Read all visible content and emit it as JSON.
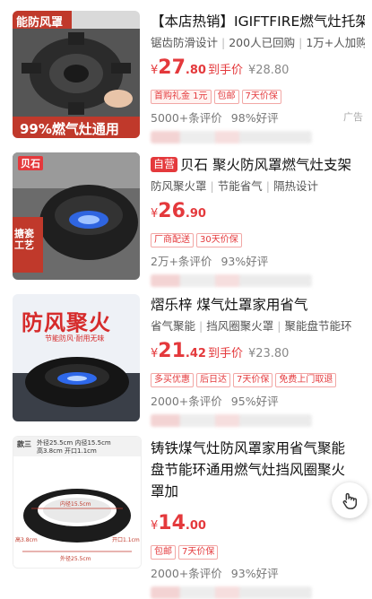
{
  "products": [
    {
      "image_text": [
        "能防风罩",
        "99%燃气灶通用"
      ],
      "title": "【本店热销】IGIFTFIRE燃气灶托架铸",
      "sub": [
        "锯齿防滑设计",
        "200人已回购",
        "1万+人加购"
      ],
      "currency": "¥",
      "price_int": "27",
      "price_dec": ".80",
      "after_label": "到手价",
      "original_price": "¥28.80",
      "chips": [
        "首购礼金 1元",
        "包邮",
        "7天价保"
      ],
      "reviews": "5000+条评价",
      "rating": "98%好评",
      "ad_label": "广告"
    },
    {
      "image_text": [
        "贝石",
        "搪瓷工艺"
      ],
      "badge": "自营",
      "title": "贝石 聚火防风罩燃气灶支架",
      "sub": [
        "防风聚火罩",
        "节能省气",
        "隔热设计"
      ],
      "currency": "¥",
      "price_int": "26",
      "price_dec": ".90",
      "chips": [
        "厂商配送",
        "30天价保"
      ],
      "reviews": "2万+条评价",
      "rating": "93%好评"
    },
    {
      "image_text": [
        "防风聚火",
        "节能防风·耐用无味"
      ],
      "title": "熠乐梓 煤气灶罩家用省气",
      "sub": [
        "省气聚能",
        "挡风圈聚火罩",
        "聚能盘节能环"
      ],
      "currency": "¥",
      "price_int": "21",
      "price_dec": ".42",
      "after_label": "到手价",
      "original_price": "¥23.80",
      "chips": [
        "多买优惠",
        "后日达",
        "7天价保",
        "免费上门取退"
      ],
      "reviews": "2000+条评价",
      "rating": "95%好评"
    },
    {
      "image_text": [
        "款三",
        "外径25.5cm 内径15.5cm",
        "高3.8cm 开口1.1cm",
        "内径15.5cm",
        "高3.8cm",
        "开口1.1cm",
        "外径25.5cm"
      ],
      "title": "铸铁煤气灶防风罩家用省气聚能盘节能环通用燃气灶挡风圈聚火罩加",
      "currency": "¥",
      "price_int": "14",
      "price_dec": ".00",
      "chips": [
        "包邮",
        "7天价保"
      ],
      "reviews": "2000+条评价",
      "rating": "93%好评"
    }
  ],
  "icons": {
    "feedback": "feedback-hand-icon"
  },
  "colors": {
    "price": "#e4393c",
    "badge": "#e4393c"
  }
}
